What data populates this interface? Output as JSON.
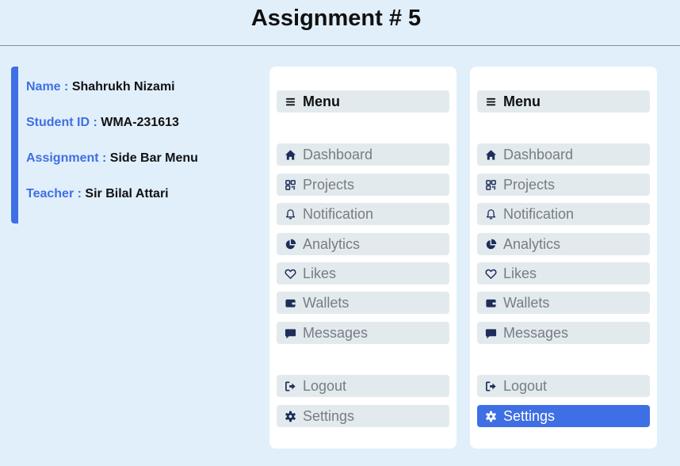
{
  "page": {
    "title": "Assignment # 5"
  },
  "info": {
    "name": {
      "label": "Name :",
      "value": "Shahrukh Nizami"
    },
    "student_id": {
      "label": "Student ID :",
      "value": "WMA-231613"
    },
    "assignment": {
      "label": "Assignment :",
      "value": "Side Bar Menu"
    },
    "teacher": {
      "label": "Teacher :",
      "value": "Sir Bilal Attari"
    }
  },
  "menu": {
    "header": "Menu",
    "items": {
      "dashboard": "Dashboard",
      "projects": "Projects",
      "notification": "Notification",
      "analytics": "Analytics",
      "likes": "Likes",
      "wallets": "Wallets",
      "messages": "Messages",
      "logout": "Logout",
      "settings": "Settings"
    }
  },
  "colors": {
    "accent": "#3f6fe4",
    "background": "#e1effb",
    "item_bg": "#e2eaee",
    "item_text": "#777d83",
    "icon": "#1f2d5a"
  },
  "icons": {
    "menu": "bars-icon",
    "dashboard": "house-icon",
    "projects": "grid-icon",
    "notification": "bell-icon",
    "analytics": "pie-chart-icon",
    "likes": "heart-icon",
    "wallets": "wallet-icon",
    "messages": "message-icon",
    "logout": "logout-icon",
    "settings": "gear-icon"
  },
  "state": {
    "panel_2_active_item": "settings"
  }
}
